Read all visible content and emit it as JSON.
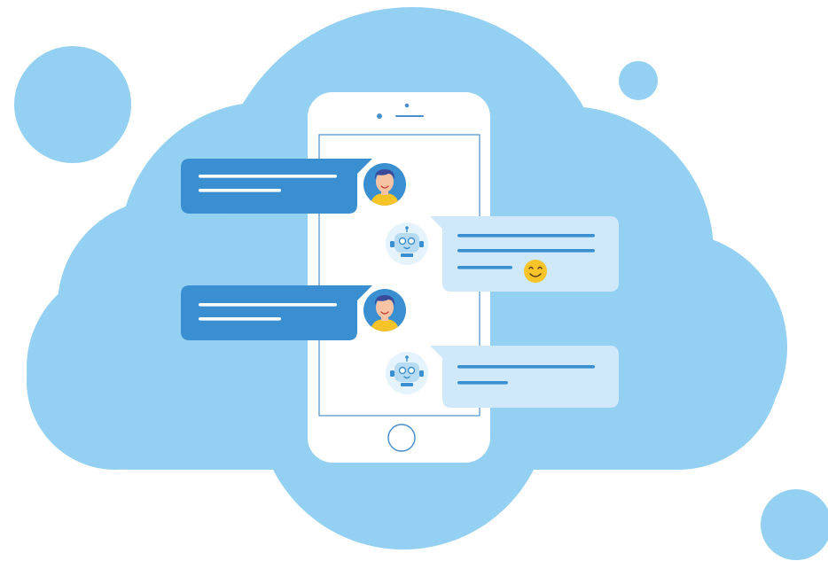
{
  "palette": {
    "background": "#ffffff",
    "cloud": "#93d0f1",
    "phone_body": "#ffffff",
    "phone_outline": "#4a8fcb",
    "user_bubble": "#3a8fd0",
    "user_bubble_text_line": "#ffffff",
    "bot_bubble": "#cfe9fa",
    "bot_bubble_text_line": "#3a8fd0",
    "user_skin": "#f6c3a4",
    "user_hair": "#3a4b9c",
    "user_shirt": "#f6c428",
    "bot_head": "#e5f3fc",
    "bot_face": "#3a8fd0",
    "emoji": "#f6c428"
  },
  "icons": {
    "user_avatar": "user-avatar-icon",
    "bot_avatar": "robot-avatar-icon",
    "emoji": "smiley-emoji-icon",
    "home_button": "home-button-icon"
  },
  "messages": [
    {
      "sender": "user",
      "text_lines": 2,
      "has_emoji": false
    },
    {
      "sender": "bot",
      "text_lines": 3,
      "has_emoji": true
    },
    {
      "sender": "user",
      "text_lines": 2,
      "has_emoji": false
    },
    {
      "sender": "bot",
      "text_lines": 2,
      "has_emoji": false
    }
  ]
}
